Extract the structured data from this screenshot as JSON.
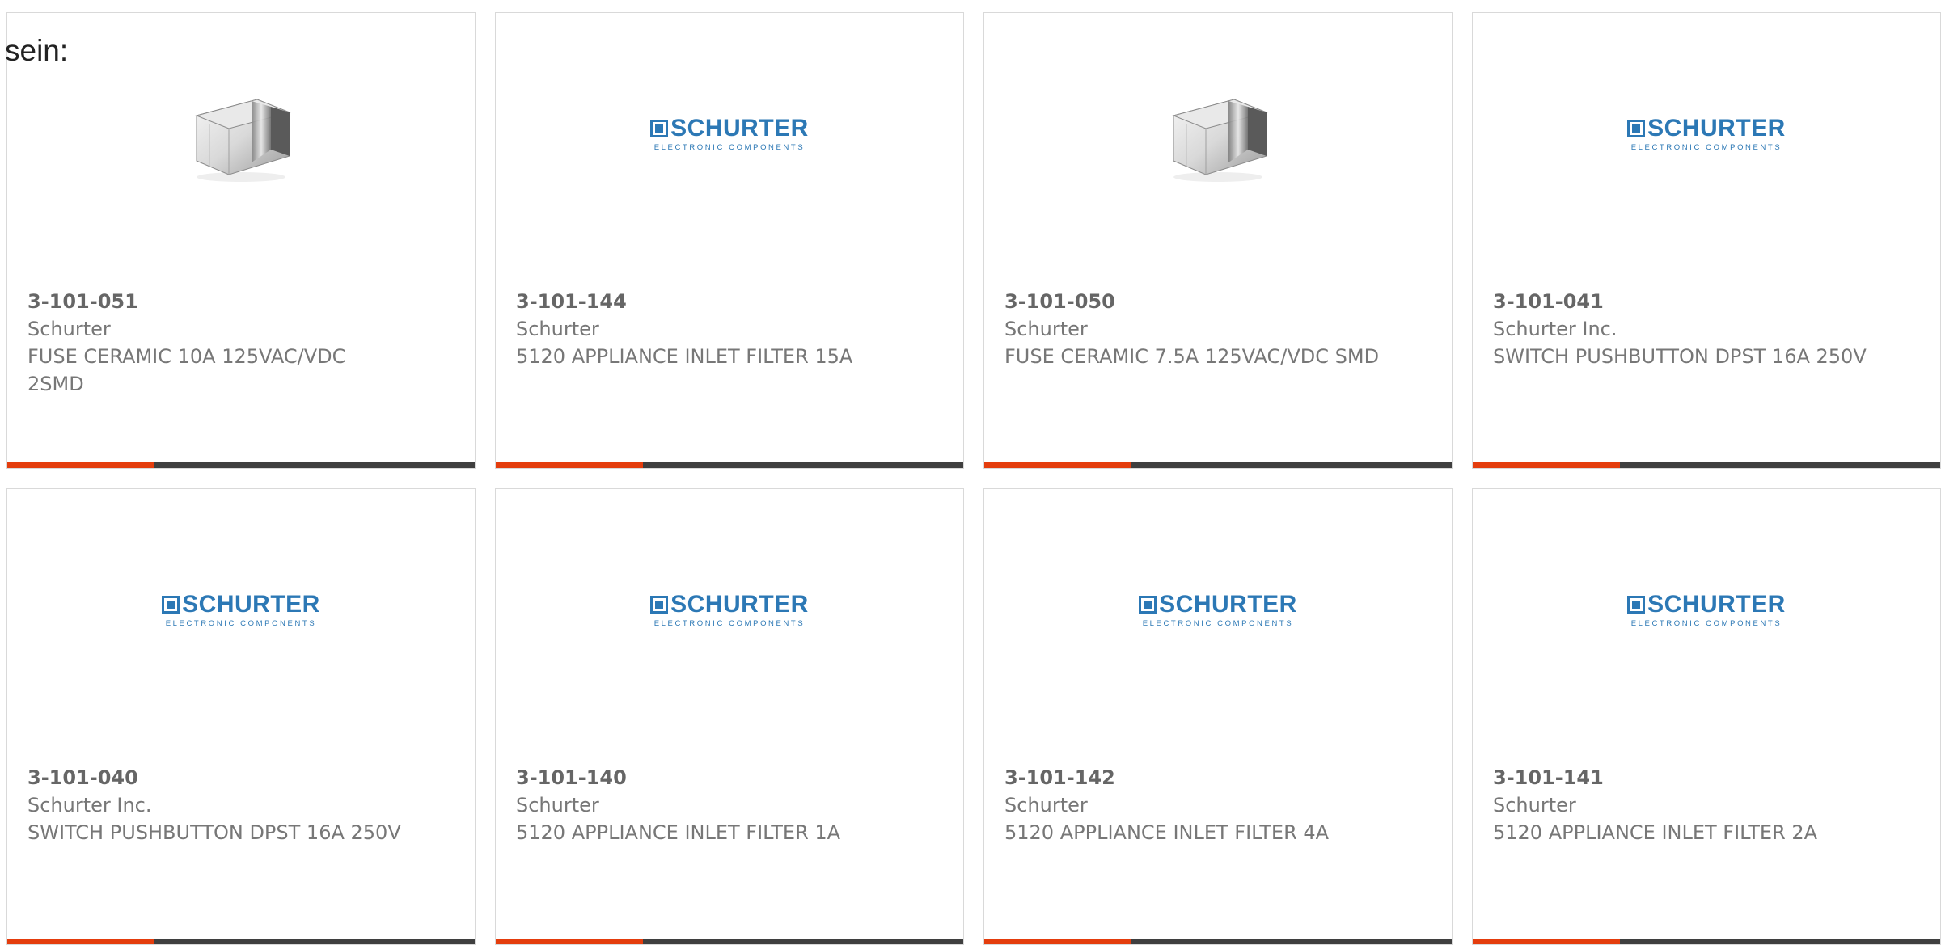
{
  "intro_text": "sein:",
  "logo": {
    "word": "SCHURTER",
    "sub": "ELECTRONIC COMPONENTS"
  },
  "colors": {
    "accent": "#e43d0d",
    "bar": "#3f3f3f",
    "brand_blue": "#2c78b5"
  },
  "products": [
    {
      "part": "3-101-051",
      "maker": "Schurter",
      "desc": "FUSE CERAMIC 10A 125VAC/VDC 2SMD",
      "image": "smd-fuse-photo"
    },
    {
      "part": "3-101-144",
      "maker": "Schurter",
      "desc": "5120 APPLIANCE INLET FILTER 15A",
      "image": "schurter-logo"
    },
    {
      "part": "3-101-050",
      "maker": "Schurter",
      "desc": "FUSE CERAMIC 7.5A 125VAC/VDC SMD",
      "image": "smd-fuse-photo"
    },
    {
      "part": "3-101-041",
      "maker": "Schurter Inc.",
      "desc": "SWITCH PUSHBUTTON DPST 16A 250V",
      "image": "schurter-logo"
    },
    {
      "part": "3-101-040",
      "maker": "Schurter Inc.",
      "desc": "SWITCH PUSHBUTTON DPST 16A 250V",
      "image": "schurter-logo"
    },
    {
      "part": "3-101-140",
      "maker": "Schurter",
      "desc": "5120 APPLIANCE INLET FILTER 1A",
      "image": "schurter-logo"
    },
    {
      "part": "3-101-142",
      "maker": "Schurter",
      "desc": "5120 APPLIANCE INLET FILTER 4A",
      "image": "schurter-logo"
    },
    {
      "part": "3-101-141",
      "maker": "Schurter",
      "desc": "5120 APPLIANCE INLET FILTER 2A",
      "image": "schurter-logo"
    }
  ]
}
